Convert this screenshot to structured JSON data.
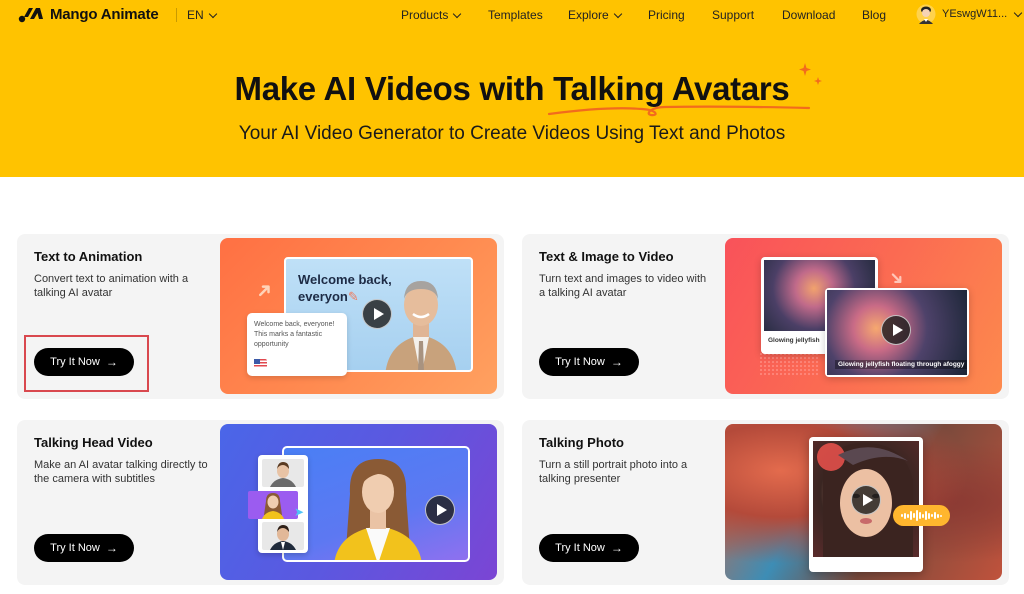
{
  "nav": {
    "brand": "Mango Animate",
    "language": "EN",
    "items": [
      {
        "label": "Products",
        "has_dropdown": true
      },
      {
        "label": "Templates",
        "has_dropdown": false
      },
      {
        "label": "Explore",
        "has_dropdown": true
      },
      {
        "label": "Pricing",
        "has_dropdown": false
      },
      {
        "label": "Support",
        "has_dropdown": false
      },
      {
        "label": "Download",
        "has_dropdown": false
      },
      {
        "label": "Blog",
        "has_dropdown": false
      }
    ],
    "user": {
      "name": "YEswgW11...",
      "icon": "user-avatar"
    }
  },
  "hero": {
    "title_prefix": "Make AI Videos with ",
    "title_highlight": "Talking Avatars",
    "subtitle": "Your AI Video Generator to Create Videos Using Text and Photos",
    "accent_color": "#ffc300",
    "underline_color": "#f26b1d"
  },
  "cards": [
    {
      "title": "Text to Animation",
      "description": "Convert text to animation with a talking AI avatar",
      "button": "Try It Now",
      "button_icon": "arrow-right-icon",
      "highlighted": true,
      "preview": {
        "screen_text_line1": "Welcome back,",
        "screen_text_line2": "everyon",
        "input_text": "Welcome back, everyone! This marks a fantastic opportunity",
        "language_icon": "us-flag-icon"
      }
    },
    {
      "title": "Text & Image to Video",
      "description": "Turn text and images to video with a talking AI avatar",
      "button": "Try It Now",
      "button_icon": "arrow-right-icon",
      "highlighted": false,
      "preview": {
        "source_caption": "Glowing jellyfish",
        "video_subtitle": "Glowing jellyfish floating through afoggy"
      }
    },
    {
      "title": "Talking Head Video",
      "description": "Make an AI avatar talking directly to the camera with subtitles",
      "button": "Try It Now",
      "button_icon": "arrow-right-icon",
      "highlighted": false,
      "preview": {}
    },
    {
      "title": "Talking Photo",
      "description": "Turn a still portrait photo into a talking presenter",
      "button": "Try It Now",
      "button_icon": "arrow-right-icon",
      "highlighted": false,
      "preview": {}
    }
  ]
}
